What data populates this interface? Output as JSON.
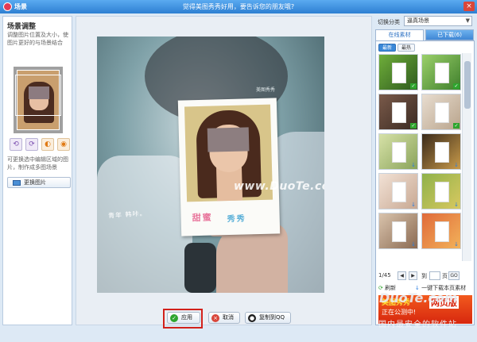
{
  "window": {
    "title": "场景",
    "promo": "觉得美图秀秀好用，要告诉您的朋友哦?",
    "close_label": "×"
  },
  "left_panel": {
    "title": "场景调整",
    "description": "调整图片位置及大小，使图片更好的与场景结合",
    "hint": "可更换选中编辑区域的图片，制作成多图场景",
    "change_image_label": "更换图片",
    "tools": [
      {
        "name": "rotate-left-icon",
        "glyph": "⟲"
      },
      {
        "name": "rotate-right-icon",
        "glyph": "⟳"
      },
      {
        "name": "filter-icon",
        "glyph": "◐"
      },
      {
        "name": "effect-icon",
        "glyph": "◉"
      }
    ]
  },
  "canvas": {
    "photo_watermark": "美图秀秀",
    "hand_text": "青年  韩咔。",
    "polaroid_sticker_left": "甜蜜",
    "polaroid_sticker_right": "秀秀",
    "site_watermark": "www.DuoTe.com"
  },
  "actions": {
    "apply_label": "应用",
    "cancel_label": "取消",
    "copy_qq_label": "复制到QQ"
  },
  "right_panel": {
    "category_label": "切换分类",
    "category_value": "逼真场景",
    "tabs": [
      {
        "label": "在线素材",
        "active": true
      },
      {
        "label": "已下载(6)",
        "active": false
      }
    ],
    "sub_buttons": [
      {
        "label": "最新",
        "active": true
      },
      {
        "label": "最热",
        "active": false
      }
    ],
    "pager": {
      "count": "1/45",
      "to_label": "到",
      "page_label": "页",
      "go_label": "GO"
    },
    "refresh_label": "刷新",
    "download_all_label": "一键下载本页素材",
    "ad": {
      "line1": "美图秀秀",
      "line1b": "网页版",
      "line2": "正在公测中!"
    }
  },
  "watermarks": {
    "logo": "DuoTe.com",
    "slogan": "国内最安全的软件站"
  }
}
